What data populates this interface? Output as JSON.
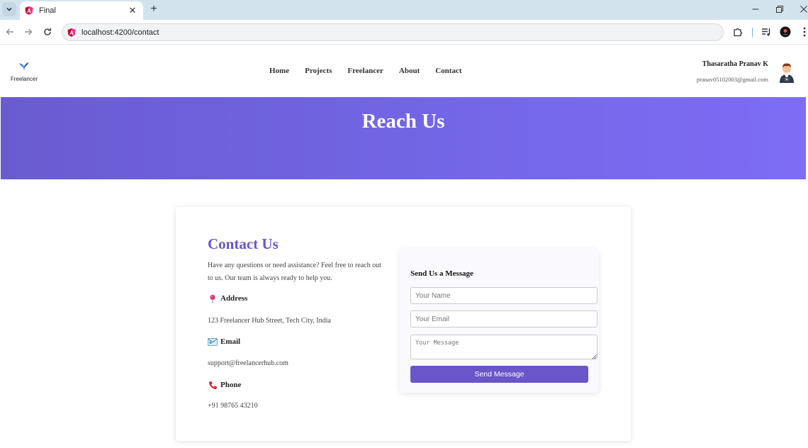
{
  "browser": {
    "tab_title": "Final",
    "new_tab_symbol": "+",
    "close_symbol": "✕",
    "url": "localhost:4200/contact"
  },
  "site": {
    "logo_text": "Freelancer",
    "nav": [
      "Home",
      "Projects",
      "Freelancer",
      "About",
      "Contact"
    ],
    "user": {
      "name": "Thasaratha Pranav K",
      "email": "pranav05102003@gmail.com"
    }
  },
  "hero": {
    "title": "Reach Us"
  },
  "contact": {
    "title": "Contact Us",
    "description": "Have any questions or need assistance? Feel free to reach out to us. Our team is always ready to help you.",
    "address_label": "Address",
    "address_value": "123 Freelancer Hub Street, Tech City, India",
    "email_label": "Email",
    "email_value": "support@freelancerhub.com",
    "phone_label": "Phone",
    "phone_value": "+91 98765 43210"
  },
  "form": {
    "title": "Send Us a Message",
    "name_placeholder": "Your Name",
    "email_placeholder": "Your Email",
    "message_placeholder": "Your Message",
    "submit_label": "Send Message"
  },
  "colors": {
    "accent": "#6a55c9",
    "hero_start": "#6a5bd0",
    "hero_end": "#7e6cf5",
    "tabstrip": "#d3e3ee"
  },
  "icons": {
    "address": "pin-icon",
    "email": "envelope-icon",
    "phone": "phone-icon"
  }
}
